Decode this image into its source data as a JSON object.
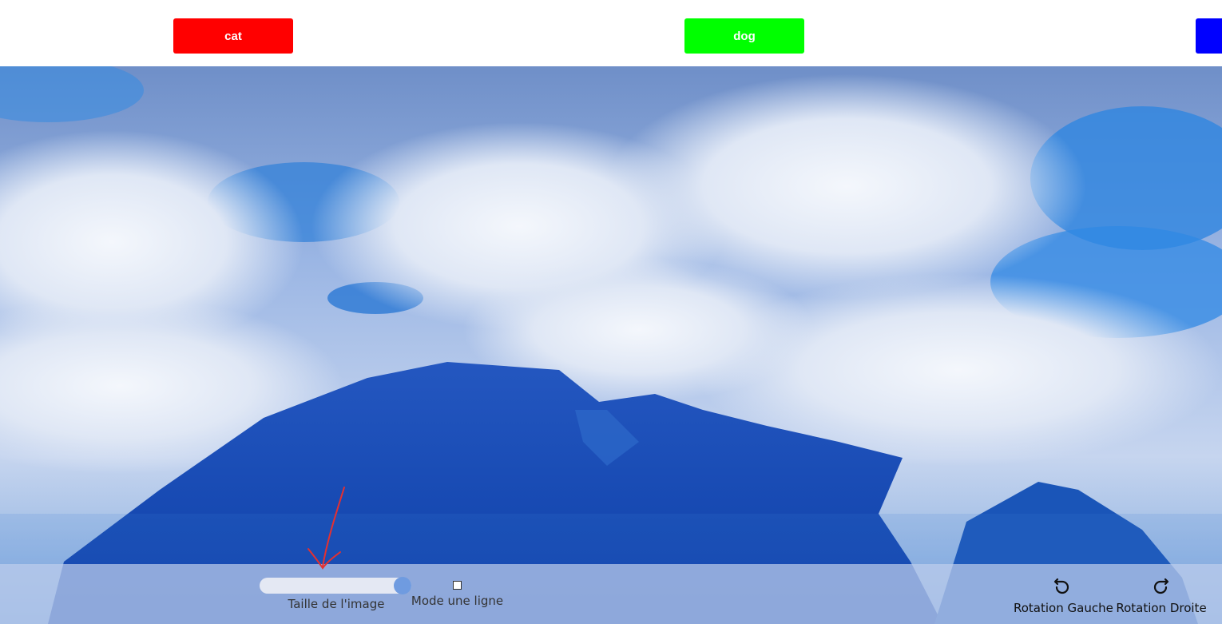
{
  "labels": [
    {
      "text": "cat",
      "color": "#ff0000"
    },
    {
      "text": "dog",
      "color": "#00ff00"
    },
    {
      "text": "",
      "color": "#0000ff"
    }
  ],
  "image": {
    "description_icon": "landscape-image"
  },
  "controls": {
    "size_slider": {
      "label": "Taille de l'image",
      "value_fraction": 1.0
    },
    "single_line_mode": {
      "label": "Mode une ligne",
      "checked": false
    },
    "rotate_left": {
      "label": "Rotation Gauche",
      "icon": "rotate-ccw-icon"
    },
    "rotate_right": {
      "label": "Rotation Droite",
      "icon": "rotate-cw-icon"
    }
  },
  "colors": {
    "accent": "#6f9be0",
    "annotation": "#e53030"
  }
}
